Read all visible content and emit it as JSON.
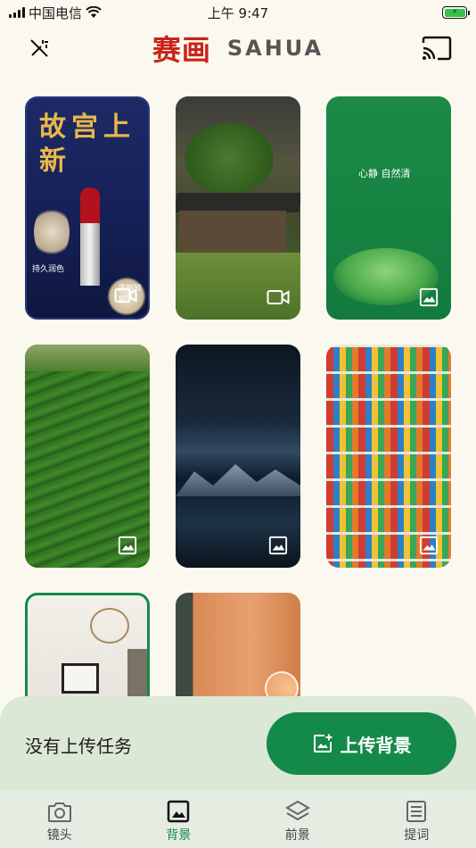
{
  "status_bar": {
    "carrier": "中国电信",
    "time": "上午 9:47"
  },
  "header": {
    "logo_cn": "赛画",
    "logo_en": "SAHUA",
    "left_icon": "magic-wand-off-icon",
    "right_icon": "cast-icon"
  },
  "grid": {
    "items": [
      {
        "type": "video",
        "caption_title": "故宫上新",
        "caption_bottom_left": "持久润色",
        "caption_bottom_right": "逐丽醉彩"
      },
      {
        "type": "video"
      },
      {
        "type": "image",
        "caption_title": "心静 自然清"
      },
      {
        "type": "image"
      },
      {
        "type": "image"
      },
      {
        "type": "image"
      },
      {
        "type": "image"
      },
      {
        "type": "image"
      }
    ]
  },
  "upload": {
    "status_text": "没有上传任务",
    "button_label": "上传背景"
  },
  "tabs": [
    {
      "label": "镜头",
      "icon": "camera-icon",
      "active": false
    },
    {
      "label": "背景",
      "icon": "image-icon",
      "active": true
    },
    {
      "label": "前景",
      "icon": "layers-icon",
      "active": false
    },
    {
      "label": "提词",
      "icon": "teleprompter-icon",
      "active": false
    }
  ],
  "colors": {
    "accent": "#138a4a",
    "background": "#fbf9ef",
    "sheet": "#dbe8d5"
  }
}
